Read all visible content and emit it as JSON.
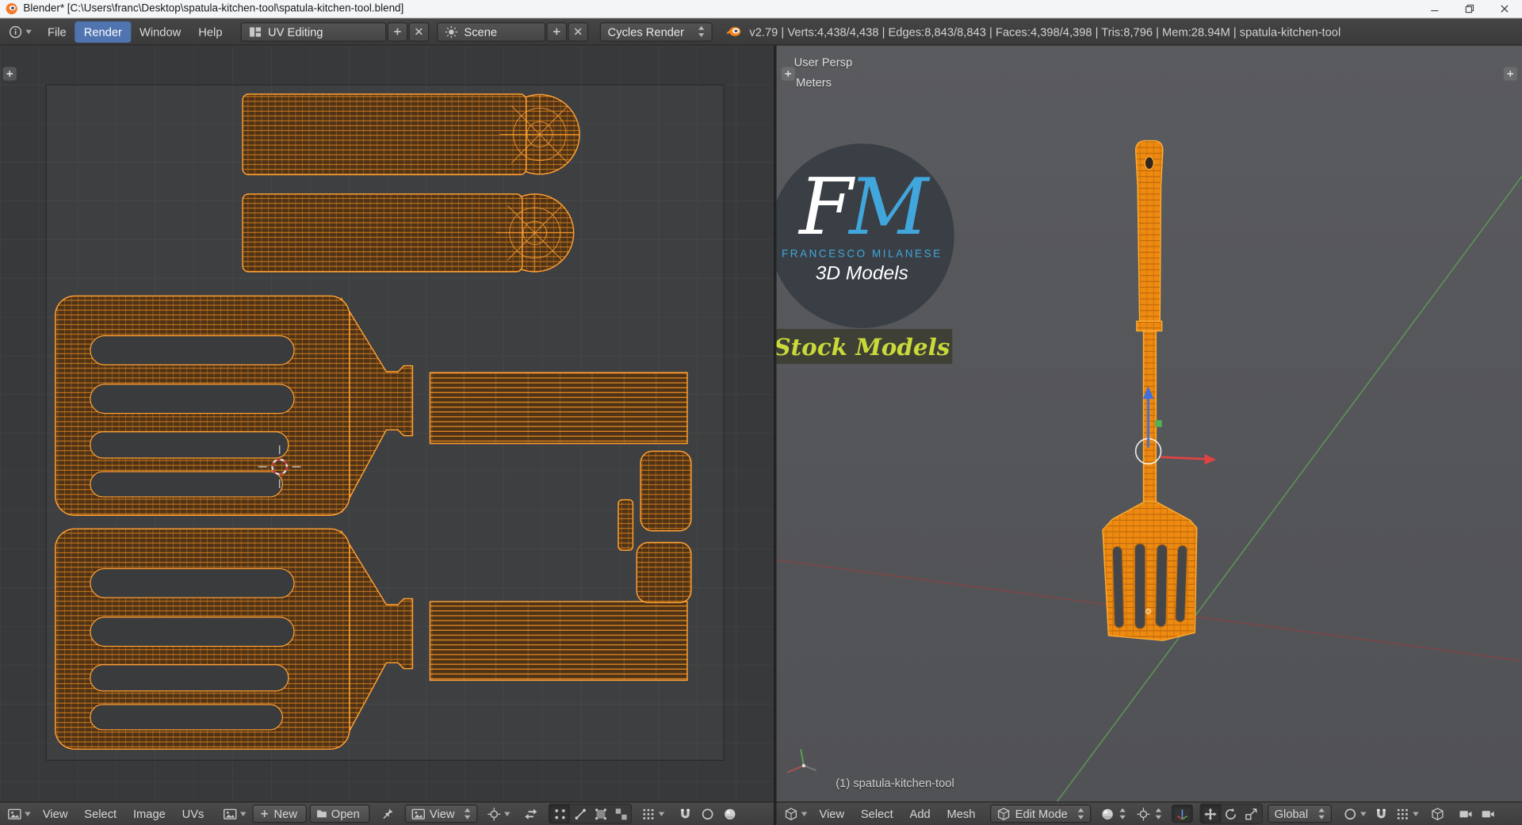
{
  "window": {
    "title": "Blender* [C:\\Users\\franc\\Desktop\\spatula-kitchen-tool\\spatula-kitchen-tool.blend]"
  },
  "topbar": {
    "menus": {
      "file": "File",
      "render": "Render",
      "window": "Window",
      "help": "Help"
    },
    "layout_value": "UV Editing",
    "scene_value": "Scene",
    "engine_value": "Cycles Render",
    "stats": "v2.79 | Verts:4,438/4,438 | Edges:8,843/8,843 | Faces:4,398/4,398 | Tris:8,796 | Mem:28.94M | spatula-kitchen-tool"
  },
  "uv_editor": {
    "menus": {
      "view": "View",
      "select": "Select",
      "image": "Image",
      "uvs": "UVs"
    },
    "new_button": "New",
    "open_button": "Open",
    "mode_value": "View"
  },
  "viewport": {
    "view_name": "User Persp",
    "units": "Meters",
    "active_object": "(1) spatula-kitchen-tool",
    "menus": {
      "view": "View",
      "select": "Select",
      "add": "Add",
      "mesh": "Mesh"
    },
    "mode_value": "Edit Mode",
    "orientation_value": "Global",
    "watermark": {
      "initial_f": "F",
      "initial_m": "M",
      "studio": "FRANCESCO MILANESE",
      "tagline": "3D Models",
      "banner": "Stock Models"
    }
  },
  "colors": {
    "uv_wireframe": "#ff9a2e",
    "mesh_selection_orange": "#f08a10",
    "active_menu_blue": "#4f74b0",
    "axis_green": "#5f9e58",
    "axis_red": "#8f4240",
    "gizmo_blue": "#3d6fe0",
    "watermark_blue": "#41a6dc",
    "watermark_yellow": "#c9d93a"
  }
}
